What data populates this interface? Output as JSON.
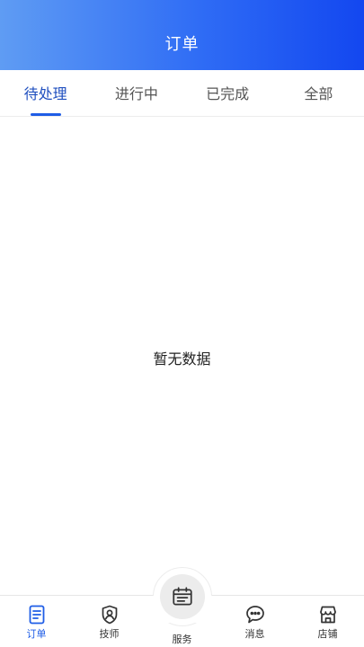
{
  "header": {
    "title": "订单"
  },
  "tabs": [
    {
      "label": "待处理",
      "active": true
    },
    {
      "label": "进行中",
      "active": false
    },
    {
      "label": "已完成",
      "active": false
    },
    {
      "label": "全部",
      "active": false
    }
  ],
  "empty_state": {
    "text": "暂无数据"
  },
  "bottom_nav": {
    "items": [
      {
        "label": "订单",
        "icon": "document-icon",
        "active": true
      },
      {
        "label": "技师",
        "icon": "technician-shield-icon",
        "active": false
      },
      {
        "label": "服务",
        "icon": "service-calendar-icon",
        "active": false
      },
      {
        "label": "消息",
        "icon": "chat-bubble-icon",
        "active": false
      },
      {
        "label": "店铺",
        "icon": "store-icon",
        "active": false
      }
    ]
  },
  "colors": {
    "header_gradient_start": "#5f9cf3",
    "header_gradient_end": "#1347f0",
    "accent": "#1f5de6",
    "tab_active": "#1f4fbf"
  }
}
